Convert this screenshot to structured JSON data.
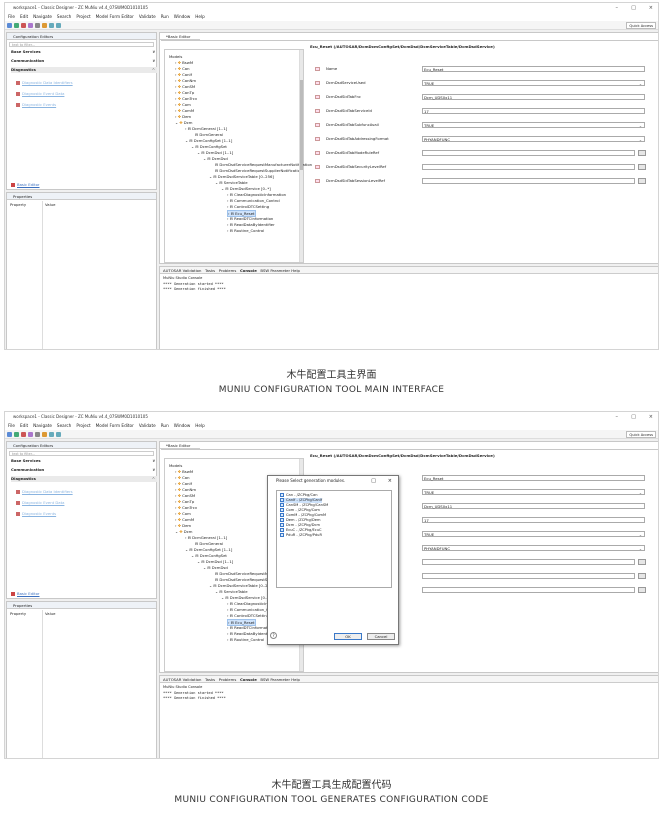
{
  "window": {
    "title": "workspace1 - Classic Designer - ZC MuNiu v4.4_07SWM0D1010105",
    "controls": [
      "–",
      "□",
      "×"
    ],
    "menu": [
      "File",
      "Edit",
      "Navigate",
      "Search",
      "Project",
      "Model Form Editor",
      "Validate",
      "Run",
      "Window",
      "Help"
    ],
    "quick_access": "Quick Access"
  },
  "config_editors": {
    "tab": "Configuration Editors",
    "filter_placeholder": "text to filter...",
    "categories": [
      "Base Services",
      "Communication",
      "Diagnostics"
    ],
    "diag_links": [
      "Diagnostic Data Identifiers",
      "Diagnostic Event Data",
      "Diagnostic Events"
    ],
    "basic_editor_link": "Basic Editor"
  },
  "properties": {
    "tab": "Properties",
    "col_property": "Property",
    "col_value": "Value"
  },
  "editor": {
    "tab": "*Basic Editor",
    "path": "Ecu_Reset (/AUTOSAR/DcmDcmConfigSet/DcmDsd/DcmServiceTable/DcmDsdService)",
    "models_label": "Models",
    "tree": [
      "BswM",
      "Can",
      "CanIf",
      "CanNm",
      "CanSM",
      "CanTp",
      "CanTrcv",
      "Com",
      "ComM",
      "Dem",
      "Dcm",
      "DcmGeneral [1..1]",
      "DcmGeneral",
      "DcmConfigSet [1..1]",
      "DcmConfigSet",
      "DcmDsd [1..1]",
      "DcmDsd",
      "DcmDsdServiceRequestManufacturerNotification",
      "DcmDsdServiceRequestSupplierNotification",
      "DcmDsdServiceTable [0..256]",
      "ServiceTable",
      "DcmDsdService [0..*]",
      "ClearDiagnosticInformation",
      "Communication_Control",
      "ControlDTCSetting",
      "Ecu_Reset",
      "ReadDTCInformation",
      "ReadDataByIdentifier",
      "Routine_Control"
    ],
    "fields": [
      {
        "label": "Name",
        "value": "Ecu_Reset",
        "kind": "text"
      },
      {
        "label": "DcmDsdServiceUsed",
        "value": "TRUE",
        "kind": "select"
      },
      {
        "label": "DcmDsdSidTabFnc",
        "value": "Dcm_UDS0x11",
        "kind": "text"
      },
      {
        "label": "DcmDsdSidTabServiceId",
        "value": "17",
        "kind": "text"
      },
      {
        "label": "DcmDsdSidTabSubfuncAvail",
        "value": "TRUE",
        "kind": "select"
      },
      {
        "label": "DcmDsdSidTabAddressingFormat",
        "value": "PHYANDFUNC",
        "kind": "select"
      },
      {
        "label": "DcmDsdSidTabModeRuleRef",
        "value": "",
        "kind": "ref"
      },
      {
        "label": "DcmDsdSidTabSecurityLevelRef",
        "value": "",
        "kind": "ref"
      },
      {
        "label": "DcmDsdSidTabSessionLevelRef",
        "value": "",
        "kind": "ref"
      }
    ]
  },
  "console": {
    "tabs": [
      "AUTOSAR Validation",
      "Tasks",
      "Problems",
      "Console",
      "BSW Parameter Help"
    ],
    "title": "MuNiu Studio Console",
    "lines": [
      "**** Generation started  ****",
      "**** Generation finished ****"
    ]
  },
  "dialog": {
    "title": "Please Select generation modules.",
    "modules": [
      "Can - /ZCPkg/Can",
      "CanIf - /ZCPkg/CanIf",
      "CanSM - /ZCPkg/CanSM",
      "Com - /ZCPkg/Com",
      "ComM - /ZCPkg/ComM",
      "Dem - /ZCPkg/Dem",
      "Dcm - /ZCPkg/Dcm",
      "EcuC - /ZCPkg/EcuC",
      "PduR - /ZCPkg/PduR"
    ],
    "ok": "OK",
    "cancel": "Cancel",
    "help": "?"
  },
  "captions": {
    "top_cn": "木牛配置工具主界面",
    "top_en": "MUNIU CONFIGURATION TOOL MAIN INTERFACE",
    "bottom_cn": "木牛配置工具生成配置代码",
    "bottom_en": "MUNIU CONFIGURATION TOOL GENERATES CONFIGURATION CODE"
  },
  "colors": {
    "accent": "#3a78c8",
    "link": "#8ab4e0",
    "selection": "#cfe3fb"
  }
}
